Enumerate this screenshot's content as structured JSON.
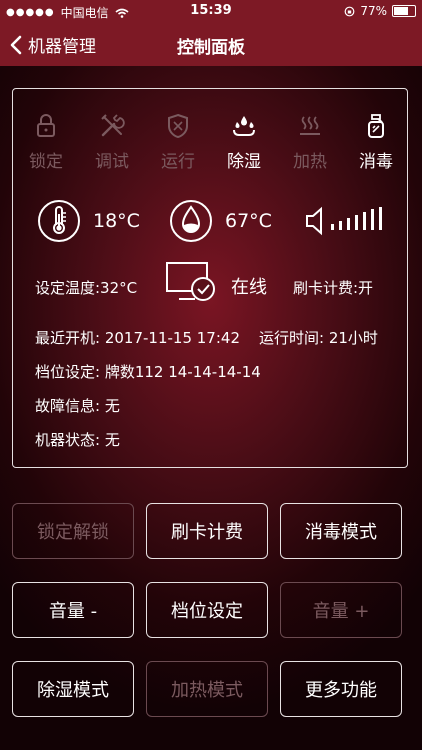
{
  "statusbar": {
    "carrier": "中国电信",
    "time": "15:39",
    "battery": "77%",
    "battery_level": 0.77
  },
  "nav": {
    "back_label": "机器管理",
    "title": "控制面板"
  },
  "modes": [
    {
      "label": "锁定",
      "icon": "lock-icon",
      "active": false
    },
    {
      "label": "调试",
      "icon": "tools-icon",
      "active": false
    },
    {
      "label": "运行",
      "icon": "run-icon",
      "active": false
    },
    {
      "label": "除湿",
      "icon": "dehumidify-icon",
      "active": true
    },
    {
      "label": "加热",
      "icon": "heat-icon",
      "active": false
    },
    {
      "label": "消毒",
      "icon": "disinfect-icon",
      "active": true
    }
  ],
  "sensors": {
    "temperature": "18°C",
    "humidity": "67°C",
    "volume_icon": "volume-icon"
  },
  "status": {
    "set_temp": "设定温度:32°C",
    "online": "在线",
    "card_billing": "刷卡计费:开"
  },
  "info": {
    "last_boot": "最近开机: 2017-11-15 17:42",
    "runtime": "运行时间: 21小时",
    "gear_setting": "档位设定: 牌数112  14-14-14-14",
    "fault": "故障信息: 无",
    "machine_state": "机器状态: 无"
  },
  "buttons": [
    {
      "label": "锁定解锁",
      "enabled": false
    },
    {
      "label": "刷卡计费",
      "enabled": true
    },
    {
      "label": "消毒模式",
      "enabled": true
    },
    {
      "label": "音量 -",
      "enabled": true
    },
    {
      "label": "档位设定",
      "enabled": true
    },
    {
      "label": "音量 +",
      "enabled": false
    },
    {
      "label": "除湿模式",
      "enabled": true
    },
    {
      "label": "加热模式",
      "enabled": false
    },
    {
      "label": "更多功能",
      "enabled": true
    }
  ]
}
